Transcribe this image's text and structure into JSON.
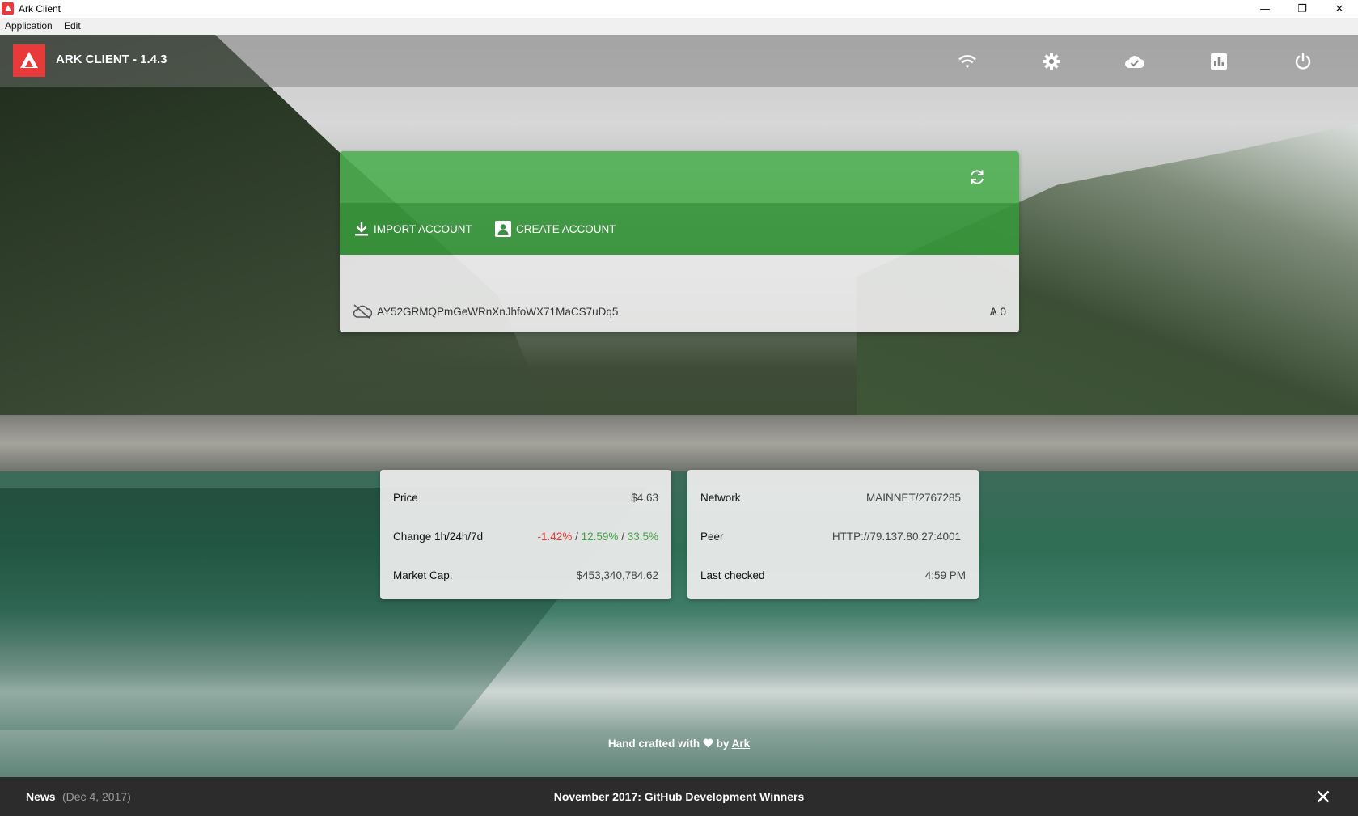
{
  "window": {
    "title": "Ark Client",
    "controls": {
      "minimize": "—",
      "maximize": "❐",
      "close": "✕"
    }
  },
  "menu": {
    "items": [
      "Application",
      "Edit"
    ]
  },
  "header": {
    "app_title": "ARK CLIENT - 1.4.3",
    "icons": [
      "wifi-icon",
      "settings-icon",
      "cloud-check-icon",
      "chart-icon",
      "power-icon"
    ]
  },
  "account_card": {
    "import_label": "IMPORT ACCOUNT",
    "create_label": "CREATE ACCOUNT",
    "address": "AY52GRMQPmGeWRnXnJhfoWX71MaCS7uDq5",
    "balance": "Ѧ 0",
    "accent_color": "#4caf50"
  },
  "market": {
    "price_label": "Price",
    "price_value": "$4.63",
    "change_label": "Change 1h/24h/7d",
    "change_1h": "-1.42%",
    "change_24h": "12.59%",
    "change_7d": "33.5%",
    "separator": "/",
    "cap_label": "Market Cap.",
    "cap_value": "$453,340,784.62"
  },
  "network": {
    "network_label": "Network",
    "network_value": "MAINNET/2767285",
    "peer_label": "Peer",
    "peer_value": "HTTP://79.137.80.27:4001",
    "checked_label": "Last checked",
    "checked_value": "4:59 PM"
  },
  "footer": {
    "credit_prefix": "Hand crafted with",
    "credit_by": "by",
    "credit_link": "Ark"
  },
  "news": {
    "label": "News",
    "date": "(Dec 4, 2017)",
    "title": "November 2017: GitHub Development Winners"
  }
}
